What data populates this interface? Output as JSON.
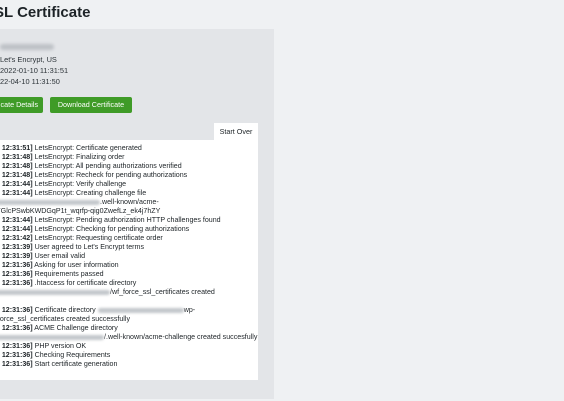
{
  "page": {
    "title": "SL Certificate"
  },
  "info": {
    "issuer": "Let's Encrypt, US",
    "valid_from": "2022-01-10 11:31:51",
    "valid_to": "22-04-10 11:31:50"
  },
  "buttons": {
    "details": "ficate Details",
    "download": "Download Certificate",
    "start_over": "Start Over"
  },
  "log": [
    {
      "time": "10 12:31:51]",
      "text": "LetsEncrypt: Certificate generated"
    },
    {
      "time": "10 12:31:48]",
      "text": "LetsEncrypt: Finalizing order"
    },
    {
      "time": "10 12:31:48]",
      "text": "LetsEncrypt: All pending authorizations verified"
    },
    {
      "time": "10 12:31:48]",
      "text": "LetsEncrypt: Recheck for pending authorizations"
    },
    {
      "time": "10 12:31:44]",
      "text": "LetsEncrypt: Verify challenge"
    },
    {
      "time": "10 12:31:44]",
      "text": "LetsEncrypt: Creating challenge file"
    },
    {
      "time": "",
      "text": ".well-known/acme-"
    },
    {
      "time": "",
      "text": "9YGlcPSwbKWDGqP1t_wqrfp-qig0ZwefLz_ek4j7hZY"
    },
    {
      "time": "10 12:31:44]",
      "text": "LetsEncrypt: Pending authorization HTTP challenges found"
    },
    {
      "time": "10 12:31:44]",
      "text": "LetsEncrypt: Checking for pending authorizations"
    },
    {
      "time": "10 12:31:42]",
      "text": "LetsEncrypt: Requesting certificate order"
    },
    {
      "time": "10 12:31:39]",
      "text": "User agreed to Let's Encrypt terms"
    },
    {
      "time": "10 12:31:39]",
      "text": "User email valid"
    },
    {
      "time": "10 12:31:36]",
      "text": "Asking for user information"
    },
    {
      "time": "10 12:31:36]",
      "text": "Requirements passed"
    },
    {
      "time": "10 12:31:36]",
      "text": ".htaccess for certificate directory"
    },
    {
      "time": "",
      "text": "/wf_force_ssl_certificates created"
    },
    {
      "time": "",
      "text": "lly"
    },
    {
      "time": "10 12:31:36]",
      "text": "Certificate directory"
    },
    {
      "time": "",
      "text": "/_force_ssl_certificates created successfully"
    },
    {
      "time": "10 12:31:36]",
      "text": "ACME Challenge directory"
    },
    {
      "time": "",
      "text": "/.well-known/acme-challenge created succesfully"
    },
    {
      "time": "10 12:31:36]",
      "text": "PHP version OK"
    },
    {
      "time": "10 12:31:36]",
      "text": "Checking Requirements"
    },
    {
      "time": "10 12:31:36]",
      "text": "Start certificate generation"
    }
  ],
  "log_extra": {
    "wp": "wp-"
  }
}
